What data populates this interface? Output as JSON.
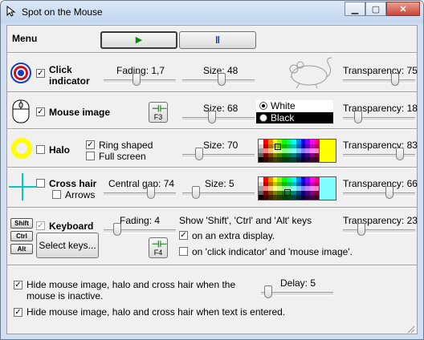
{
  "window": {
    "title": "Spot on the Mouse"
  },
  "menu": {
    "label": "Menu",
    "play_symbol": "▶",
    "pause_symbol": "⏸"
  },
  "click_indicator": {
    "label_line1": "Click",
    "label_line2": "indicator",
    "checked": true,
    "fading_label": "Fading: 1,7",
    "fading": 0.45,
    "size_label": "Size: 48",
    "size": 0.55,
    "transparency_label": "Transparency: 75",
    "transparency": 0.75
  },
  "mouse_image": {
    "label": "Mouse image",
    "checked": true,
    "hotkey": "F3",
    "size_label": "Size: 68",
    "size": 0.4,
    "color_white": "White",
    "color_black": "Black",
    "selected_color": "White",
    "transparency_label": "Transparency: 18",
    "transparency": 0.18
  },
  "halo": {
    "label": "Halo",
    "checked": false,
    "ring_shaped_label": "Ring shaped",
    "ring_shaped": true,
    "full_screen_label": "Full screen",
    "full_screen": false,
    "size_label": "Size: 70",
    "size": 0.2,
    "color": "#ffff00",
    "transparency_label": "Transparency: 83",
    "transparency": 0.83
  },
  "cross_hair": {
    "label": "Cross hair",
    "checked": false,
    "arrows_label": "Arrows",
    "arrows": false,
    "gap_label": "Central gap: 74",
    "gap": 0.68,
    "size_label": "Size: 5",
    "size": 0.15,
    "color": "#80ffff",
    "transparency_label": "Transparency: 66",
    "transparency": 0.66
  },
  "keyboard": {
    "label": "Keyboard",
    "checked": true,
    "keys": [
      "Shift",
      "Ctrl",
      "Alt"
    ],
    "select_keys_label": "Select keys...",
    "hotkey": "F4",
    "fading_label": "Fading: 4",
    "fading": 0.15,
    "show_text": "Show 'Shift', 'Ctrl' and 'Alt' keys",
    "extra_display_label": "on an extra display.",
    "extra_display": true,
    "indicator_label": "on 'click indicator' and 'mouse image'.",
    "indicator": false,
    "transparency_label": "Transparency: 23",
    "transparency": 0.23
  },
  "options": {
    "hide_inactive_line1": "Hide mouse image, halo and cross hair when the",
    "hide_inactive_line2": "mouse is inactive.",
    "hide_inactive": true,
    "delay_label": "Delay: 5",
    "delay": 0.05,
    "hide_text_label": "Hide mouse image, halo and cross hair when text is entered.",
    "hide_text": true
  },
  "colors": {
    "accent_green": "#0a8a0a",
    "pause_blue": "#1030a0",
    "target_red": "#d01020",
    "target_blue": "#1040c0"
  }
}
